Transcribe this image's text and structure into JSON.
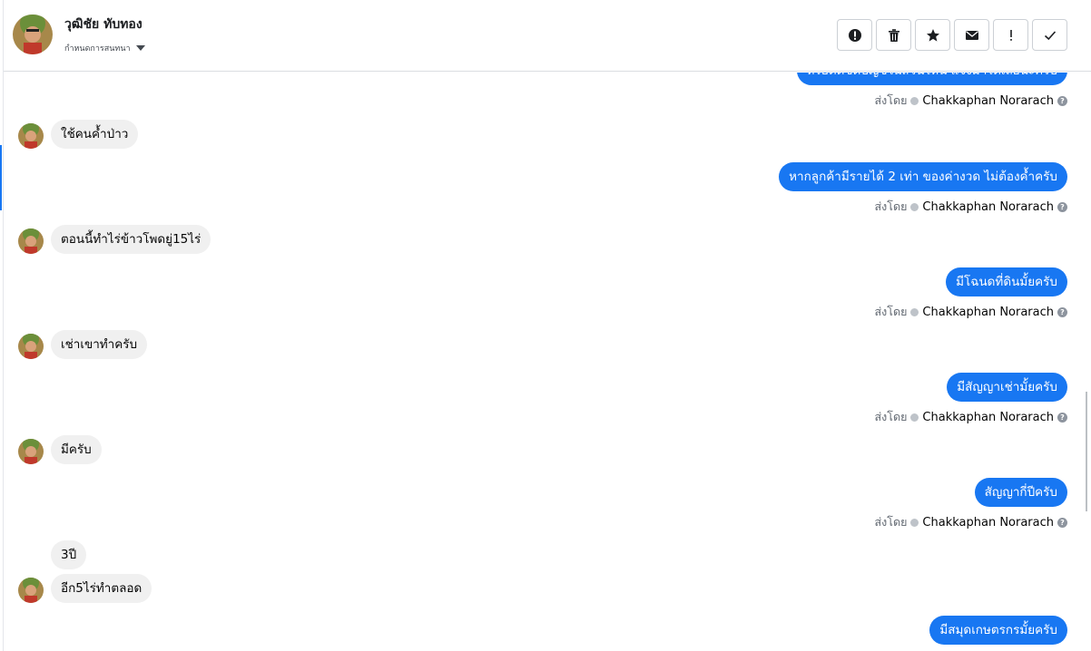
{
  "header": {
    "name": "วุฒิชัย ทับทอง",
    "subtitle": "กำหนดการสนทนา",
    "actions": [
      {
        "name": "report-icon"
      },
      {
        "name": "trash-icon"
      },
      {
        "name": "star-icon"
      },
      {
        "name": "envelope-icon"
      },
      {
        "name": "exclamation-icon"
      },
      {
        "name": "check-icon"
      }
    ]
  },
  "sent_by_label": "ส่งโดย",
  "agent_name": "Chakkaphan Norarach",
  "messages": {
    "out_0": "หรือตัดชดบัญชีในส่วนไหน แจ้งมาได้เลยนะครับ",
    "in_1": "ใช้คนค้ำป่าว",
    "out_2": "หากลูกค้ามีรายได้ 2 เท่า ของค่างวด ไม่ต้องค้ำครับ",
    "in_3": "ตอนนี้ทำไร่ข้าวโพดยู่15ไร่",
    "out_4": "มีโฉนดที่ดินมั้ยครับ",
    "in_5": "เช่าเขาทำครับ",
    "out_6": "มีสัญญาเช่ามั้ยครับ",
    "in_7": "มีครับ",
    "out_8": "สัญญากี่ปีครับ",
    "in_9": "3ปี",
    "in_10": "อีก5ไร่ทำตลอด",
    "out_11": "มีสมุดเกษตรกรมั้ยครับ"
  },
  "colors": {
    "outgoing_bubble": "#1877f2",
    "incoming_bubble": "#f0f0f0"
  }
}
